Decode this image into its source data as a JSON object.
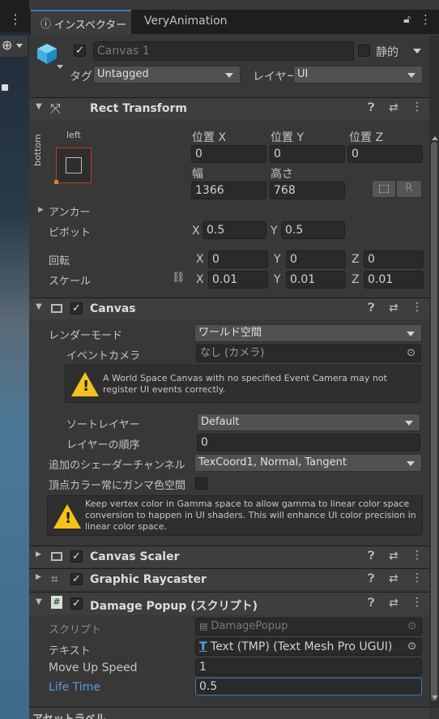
{
  "tabs": {
    "inspector": "インスペクター",
    "very_animation": "VeryAnimation"
  },
  "object": {
    "name": "Canvas 1",
    "static_label": "静的",
    "tag_label": "タグ",
    "tag_value": "Untagged",
    "layer_label": "レイヤー",
    "layer_value": "UI"
  },
  "rect_transform": {
    "title": "Rect Transform",
    "anchor_left": "left",
    "anchor_bottom": "bottom",
    "pos_x_label": "位置 X",
    "pos_y_label": "位置 Y",
    "pos_z_label": "位置 Z",
    "pos_x": "0",
    "pos_y": "0",
    "pos_z": "0",
    "width_label": "幅",
    "height_label": "高さ",
    "width": "1366",
    "height": "768",
    "r_button": "R",
    "anchor_label": "アンカー",
    "pivot_label": "ピボット",
    "pivot_x": "0.5",
    "pivot_y": "0.5",
    "rotation_label": "回転",
    "rot_x": "0",
    "rot_y": "0",
    "rot_z": "0",
    "scale_label": "スケール",
    "scale_x": "0.01",
    "scale_y": "0.01",
    "scale_z": "0.01",
    "x": "X",
    "y": "Y",
    "z": "Z"
  },
  "canvas": {
    "title": "Canvas",
    "render_mode_label": "レンダーモード",
    "render_mode_value": "ワールド空間",
    "event_camera_label": "イベントカメラ",
    "event_camera_value": "なし (カメラ)",
    "warning1": "A World Space Canvas with no specified Event Camera may not register UI events correctly.",
    "sorting_layer_label": "ソートレイヤー",
    "sorting_layer_value": "Default",
    "order_label": "レイヤーの順序",
    "order_value": "0",
    "shader_channels_label": "追加のシェーダーチャンネル",
    "shader_channels_value": "TexCoord1, Normal, Tangent",
    "vertex_color_label": "頂点カラー常にガンマ色空間",
    "warning2": "Keep vertex color in Gamma space to allow gamma to linear color space conversion to happen in UI shaders. This will enhance UI color precision in linear color space."
  },
  "canvas_scaler": {
    "title": "Canvas Scaler"
  },
  "graphic_raycaster": {
    "title": "Graphic Raycaster"
  },
  "damage_popup": {
    "title": "Damage Popup (スクリプト)",
    "script_label": "スクリプト",
    "script_value": "DamagePopup",
    "text_label": "テキスト",
    "text_value": "Text (TMP) (Text Mesh Pro UGUI)",
    "move_up_speed_label": "Move Up Speed",
    "move_up_speed_value": "1",
    "life_time_label": "Life Time",
    "life_time_value": "0.5"
  },
  "asset_labels": "アセットラベル",
  "colors": {
    "accent": "#3a79bb",
    "warning": "#f5c21b",
    "life_time_label": "#5b9bdc"
  }
}
